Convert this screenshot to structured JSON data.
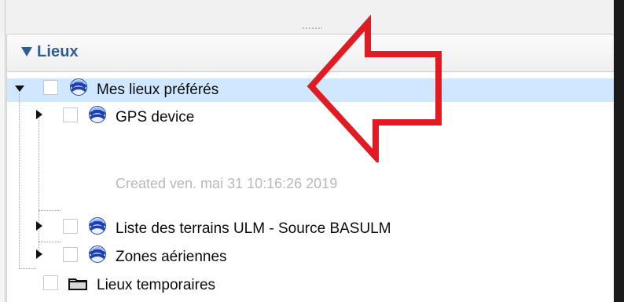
{
  "panel": {
    "title": "Lieux",
    "expanded": true
  },
  "tree": {
    "items": [
      {
        "label": "Mes lieux préférés",
        "icon": "globe-icon",
        "selected": true,
        "expanded": true
      },
      {
        "label": "GPS device",
        "icon": "globe-icon",
        "description": "Created ven. mai 31 10:16:26 2019",
        "expanded": false
      },
      {
        "label": "Liste des terrains ULM - Source BASULM",
        "icon": "globe-icon",
        "expanded": false
      },
      {
        "label": "Zones aériennes",
        "icon": "globe-icon",
        "expanded": false
      },
      {
        "label": "Lieux temporaires",
        "icon": "folder-icon",
        "expanded": false
      }
    ]
  },
  "annotation": {
    "icon": "red-arrow-annotation",
    "color": "#e11b22"
  },
  "colors": {
    "header_text": "#315c93",
    "selection": "#cfe8ff",
    "description_text": "#b8b8b8",
    "globe_blue": "#1e3fae",
    "annotation_red": "#e11b22"
  }
}
